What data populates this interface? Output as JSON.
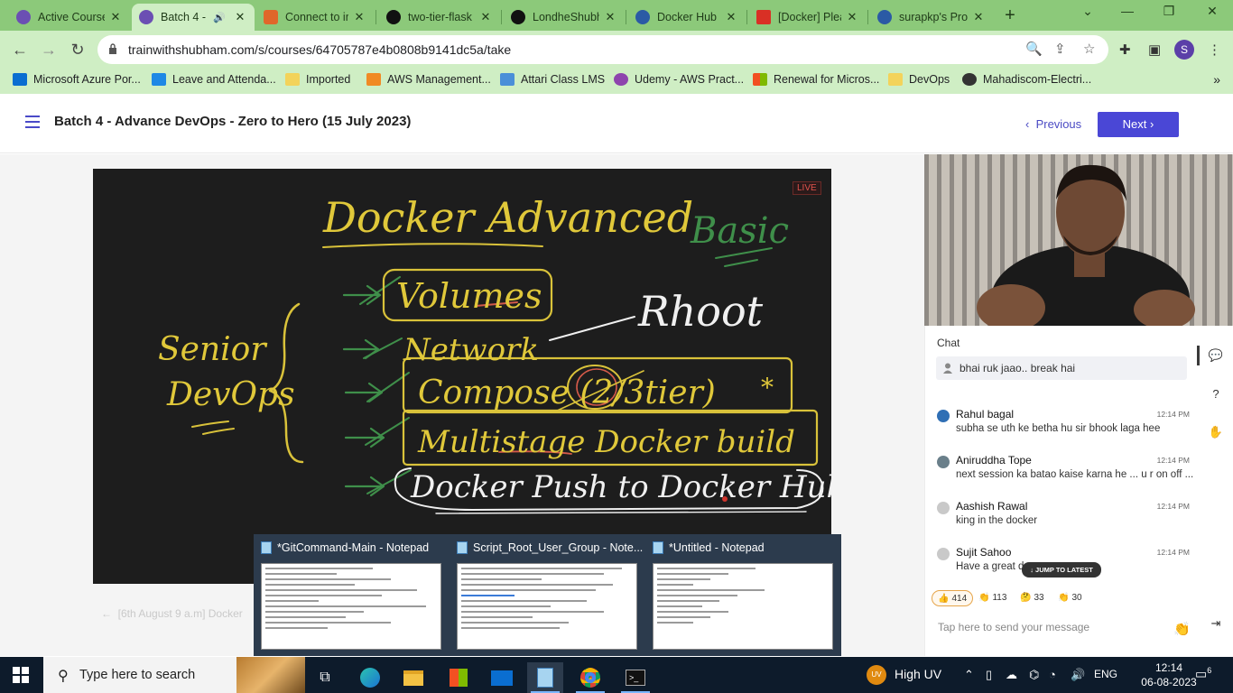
{
  "browser": {
    "tabs": [
      {
        "title": "Active Course",
        "fav_color": "#6b4fb3",
        "active": false
      },
      {
        "title": "Batch 4 -",
        "fav_color": "#6b4fb3",
        "active": true,
        "audio_icon": "speaker-icon"
      },
      {
        "title": "Connect to ir",
        "fav_color": "#e0672a",
        "active": false
      },
      {
        "title": "two-tier-flask",
        "fav_color": "#111111",
        "active": false
      },
      {
        "title": "LondheShubh",
        "fav_color": "#111111",
        "active": false
      },
      {
        "title": "Docker Hub",
        "fav_color": "#2b5aa5",
        "active": false
      },
      {
        "title": "[Docker] Plea",
        "fav_color": "#d93025",
        "active": false
      },
      {
        "title": "surapkp's Pro",
        "fav_color": "#2b5aa5",
        "active": false
      }
    ],
    "url": "trainwithshubham.com/s/courses/64705787e4b0808b9141dc5a/take",
    "profile_initial": "S",
    "bookmarks": [
      {
        "label": "Microsoft Azure Por...",
        "color": "#0a6ed1"
      },
      {
        "label": "Leave and Attenda...",
        "color": "#1e88e5"
      },
      {
        "label": "Imported",
        "color": "#f3d35b"
      },
      {
        "label": "AWS Management...",
        "color": "#f08a24"
      },
      {
        "label": "Attari Class LMS",
        "color": "#4a8fd8"
      },
      {
        "label": "Udemy - AWS Pract...",
        "color": "#8e44ad"
      },
      {
        "label": "Renewal for Micros...",
        "color": "#f25022"
      },
      {
        "label": "DevOps",
        "color": "#f3d35b"
      },
      {
        "label": "Mahadiscom-Electri...",
        "color": "#333333"
      }
    ]
  },
  "course": {
    "title": "Batch 4 - Advance DevOps - Zero to Hero (15 July 2023)",
    "prev_label": "Previous",
    "next_label": "Next",
    "live_badge": "LIVE",
    "next_lesson_text": "[6th August 9 a.m] Docker",
    "accent_color": "#4a47d6"
  },
  "whiteboard": {
    "title": "Docker Advanced",
    "note_right": "Basic",
    "note_root": "Rhoot",
    "side_label_1": "Senior",
    "side_label_2": "DevOps",
    "items": [
      "Volumes",
      "Network",
      "Compose (2/3tier)",
      "Multistage Docker build",
      "Docker Push to Docker Hub"
    ],
    "star": "*",
    "circled_number": "2"
  },
  "chat": {
    "header": "Chat",
    "pinned": "bhai ruk jaao.. break hai",
    "messages": [
      {
        "name": "Rahul bagal",
        "time": "12:14 PM",
        "text": "subha se uth ke betha hu sir bhook laga hee"
      },
      {
        "name": "Aniruddha Tope",
        "time": "12:14 PM",
        "text": "next session ka batao kaise karna he ... u r on off ..."
      },
      {
        "name": "Aashish Rawal",
        "time": "12:14 PM",
        "text": "king in the docker"
      },
      {
        "name": "Sujit Sahoo",
        "time": "12:14 PM",
        "text": "Have a great d"
      }
    ],
    "jump_label": "↓ JUMP TO LATEST",
    "reactions": [
      {
        "emoji": "👍",
        "count": "414"
      },
      {
        "emoji": "👏",
        "count": "113"
      },
      {
        "emoji": "🤔",
        "count": "33"
      },
      {
        "emoji": "👏",
        "count": "30"
      }
    ],
    "input_placeholder": "Tap here to send your message"
  },
  "previews": [
    {
      "title": "*GitCommand-Main - Notepad"
    },
    {
      "title": "Script_Root_User_Group - Note..."
    },
    {
      "title": "*Untitled - Notepad"
    }
  ],
  "taskbar": {
    "search_placeholder": "Type here to search",
    "weather": "High UV",
    "weather_badge": "UV",
    "language": "ENG",
    "time": "12:14",
    "date": "06-08-2023",
    "notif_count": "6"
  }
}
